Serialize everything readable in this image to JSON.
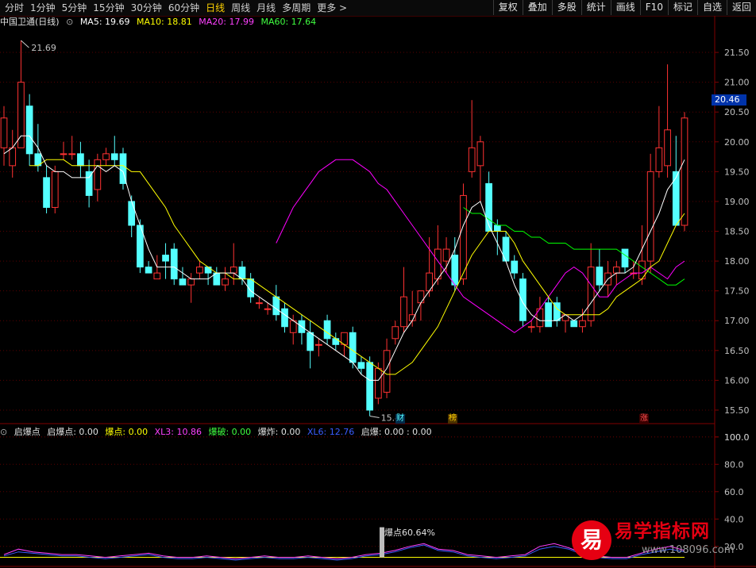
{
  "toolbar": {
    "periods": [
      "分时",
      "1分钟",
      "5分钟",
      "15分钟",
      "30分钟",
      "60分钟",
      "日线",
      "周线",
      "月线",
      "多周期",
      "更多 >"
    ],
    "active_period": "日线",
    "tools": [
      "复权",
      "叠加",
      "多股",
      "统计",
      "画线",
      "F10",
      "标记",
      "自选",
      "返回"
    ]
  },
  "price_legend": {
    "title": "中国卫通(日线)",
    "ma5": "MA5: 19.69",
    "ma10": "MA10: 18.81",
    "ma20": "MA20: 17.99",
    "ma60": "MA60: 17.64"
  },
  "indicator_legend": {
    "name": "启爆点",
    "qbd": "启爆点: 0.00",
    "bd": "爆点: 0.00",
    "xl3": "XL3: 10.86",
    "bp": "爆破: 0.00",
    "bz": "爆炸: 0.00",
    "xl6": "XL6: 12.76",
    "qb": "启爆: 0.00 : 0.00"
  },
  "current_price": "20.46",
  "high_label": "21.69",
  "low_label": "15.47",
  "markers": [
    "财",
    "榜",
    "涨"
  ],
  "indicator_annotation": "爆点60.64%",
  "watermark": {
    "badge": "易",
    "title": "易学指标网",
    "url": "www.108096.com"
  },
  "colors": {
    "up": "#ff3232",
    "down": "#54ffff",
    "ma5": "#ffffff",
    "ma10": "#ffff00",
    "ma20": "#ff00ff",
    "ma60": "#00ff00",
    "axis": "#800000"
  },
  "chart_data": [
    {
      "type": "candlestick",
      "title": "中国卫通(日线)",
      "y_ticks": [
        15.5,
        16.0,
        16.5,
        17.0,
        17.5,
        18.0,
        18.5,
        19.0,
        19.5,
        20.0,
        20.5,
        21.0,
        21.5
      ],
      "ylim": [
        15.3,
        21.9
      ],
      "ohlc": [
        [
          19.9,
          20.6,
          19.6,
          20.4
        ],
        [
          19.6,
          20.2,
          19.4,
          19.9
        ],
        [
          19.9,
          21.7,
          19.9,
          21.0
        ],
        [
          20.6,
          20.8,
          19.6,
          19.8
        ],
        [
          19.8,
          20.3,
          19.5,
          19.6
        ],
        [
          19.4,
          19.6,
          18.8,
          18.9
        ],
        [
          18.9,
          19.6,
          18.8,
          19.5
        ],
        [
          19.8,
          20.0,
          19.7,
          19.8
        ],
        [
          19.8,
          20.1,
          19.7,
          19.8
        ],
        [
          19.8,
          20.0,
          19.4,
          19.6
        ],
        [
          19.5,
          19.7,
          18.9,
          19.1
        ],
        [
          19.2,
          19.8,
          19.0,
          19.7
        ],
        [
          19.7,
          19.9,
          19.6,
          19.8
        ],
        [
          19.8,
          20.1,
          19.6,
          19.7
        ],
        [
          19.8,
          19.9,
          19.2,
          19.3
        ],
        [
          19.0,
          19.1,
          18.4,
          18.6
        ],
        [
          18.6,
          18.7,
          17.8,
          17.9
        ],
        [
          17.9,
          18.0,
          17.8,
          17.8
        ],
        [
          17.7,
          18.1,
          17.7,
          17.8
        ],
        [
          18.1,
          18.3,
          17.7,
          18.0
        ],
        [
          18.2,
          18.3,
          17.6,
          17.7
        ],
        [
          17.7,
          17.9,
          17.6,
          17.6
        ],
        [
          17.6,
          17.8,
          17.3,
          17.7
        ],
        [
          17.8,
          18.0,
          17.7,
          17.9
        ],
        [
          17.9,
          17.9,
          17.6,
          17.8
        ],
        [
          17.8,
          17.9,
          17.6,
          17.6
        ],
        [
          17.6,
          17.9,
          17.5,
          17.7
        ],
        [
          17.8,
          18.3,
          17.6,
          17.9
        ],
        [
          17.9,
          18.0,
          17.6,
          17.7
        ],
        [
          17.7,
          17.8,
          17.3,
          17.4
        ],
        [
          17.3,
          17.4,
          17.2,
          17.3
        ],
        [
          17.2,
          17.3,
          17.1,
          17.2
        ],
        [
          17.4,
          17.6,
          17.0,
          17.1
        ],
        [
          17.2,
          17.3,
          16.8,
          16.9
        ],
        [
          16.8,
          17.1,
          16.6,
          17.0
        ],
        [
          17.0,
          17.1,
          16.6,
          16.8
        ],
        [
          16.8,
          17.0,
          16.2,
          16.5
        ],
        [
          16.6,
          16.7,
          16.4,
          16.6
        ],
        [
          17.0,
          17.1,
          16.6,
          16.7
        ],
        [
          16.7,
          16.8,
          16.5,
          16.6
        ],
        [
          16.6,
          16.8,
          16.4,
          16.8
        ],
        [
          16.8,
          16.9,
          16.2,
          16.3
        ],
        [
          16.3,
          16.4,
          16.1,
          16.2
        ],
        [
          16.3,
          16.4,
          15.4,
          15.5
        ],
        [
          15.7,
          16.3,
          15.6,
          16.2
        ],
        [
          15.8,
          16.7,
          15.7,
          16.5
        ],
        [
          16.7,
          17.0,
          16.6,
          16.9
        ],
        [
          16.9,
          17.9,
          16.8,
          17.4
        ],
        [
          17.0,
          17.5,
          16.9,
          17.1
        ],
        [
          17.3,
          17.5,
          17.0,
          17.5
        ],
        [
          17.5,
          18.4,
          17.4,
          17.8
        ],
        [
          17.7,
          18.6,
          17.6,
          18.2
        ],
        [
          18.0,
          18.4,
          17.8,
          18.2
        ],
        [
          18.1,
          18.4,
          17.5,
          17.6
        ],
        [
          17.7,
          19.3,
          17.6,
          19.1
        ],
        [
          19.5,
          20.7,
          19.4,
          19.9
        ],
        [
          19.6,
          20.1,
          19.0,
          20.0
        ],
        [
          19.3,
          19.5,
          18.5,
          18.5
        ],
        [
          18.6,
          18.7,
          18.1,
          18.5
        ],
        [
          18.4,
          18.5,
          18.0,
          18.0
        ],
        [
          18.0,
          18.1,
          17.7,
          17.8
        ],
        [
          17.7,
          17.8,
          16.9,
          17.0
        ],
        [
          16.9,
          17.0,
          16.8,
          16.9
        ],
        [
          16.9,
          17.4,
          16.8,
          17.2
        ],
        [
          17.3,
          17.4,
          16.9,
          16.9
        ],
        [
          17.3,
          17.4,
          16.9,
          17.0
        ],
        [
          17.0,
          17.1,
          16.8,
          17.1
        ],
        [
          17.0,
          17.0,
          16.9,
          16.9
        ],
        [
          16.9,
          17.2,
          16.8,
          17.0
        ],
        [
          17.0,
          18.3,
          16.9,
          17.9
        ],
        [
          17.9,
          18.2,
          17.5,
          17.6
        ],
        [
          17.6,
          18.0,
          17.4,
          17.8
        ],
        [
          17.8,
          18.0,
          17.6,
          17.9
        ],
        [
          18.2,
          18.2,
          17.8,
          17.9
        ],
        [
          17.8,
          18.0,
          17.7,
          17.8
        ],
        [
          17.7,
          18.6,
          17.6,
          18.0
        ],
        [
          18.0,
          19.8,
          17.8,
          19.5
        ],
        [
          19.5,
          20.6,
          19.4,
          19.9
        ],
        [
          19.6,
          21.3,
          19.4,
          20.2
        ],
        [
          19.5,
          20.1,
          18.6,
          18.6
        ],
        [
          18.6,
          20.5,
          18.5,
          20.4
        ]
      ],
      "ma5": [
        19.8,
        19.9,
        20.1,
        20.1,
        19.9,
        19.6,
        19.5,
        19.5,
        19.4,
        19.4,
        19.4,
        19.6,
        19.5,
        19.6,
        19.5,
        19.0,
        18.6,
        18.2,
        17.9,
        17.9,
        17.9,
        17.8,
        17.7,
        17.7,
        17.7,
        17.8,
        17.8,
        17.8,
        17.7,
        17.5,
        17.4,
        17.3,
        17.2,
        17.1,
        17.0,
        16.9,
        16.8,
        16.7,
        16.6,
        16.5,
        16.4,
        16.3,
        16.1,
        16.0,
        16.0,
        16.2,
        16.5,
        16.8,
        17.0,
        17.3,
        17.5,
        17.7,
        17.9,
        18.2,
        18.6,
        18.9,
        19.0,
        18.6,
        18.3,
        18.0,
        17.6,
        17.3,
        17.1,
        17.0,
        17.0,
        17.0,
        17.1,
        17.0,
        17.1,
        17.3,
        17.5,
        17.7,
        17.8,
        17.8,
        17.9,
        18.2,
        18.5,
        18.8,
        19.2,
        19.4,
        19.7
      ],
      "ma10": [
        19.6,
        19.6,
        19.7,
        19.7,
        19.7,
        19.6,
        19.6,
        19.6,
        19.6,
        19.6,
        19.6,
        19.6,
        19.5,
        19.5,
        19.3,
        19.1,
        18.9,
        18.6,
        18.4,
        18.2,
        18.0,
        17.9,
        17.8,
        17.8,
        17.7,
        17.7,
        17.7,
        17.6,
        17.5,
        17.4,
        17.3,
        17.2,
        17.1,
        17.0,
        16.9,
        16.8,
        16.7,
        16.6,
        16.5,
        16.4,
        16.3,
        16.2,
        16.1,
        16.1,
        16.2,
        16.3,
        16.5,
        16.7,
        16.9,
        17.2,
        17.5,
        17.8,
        18.1,
        18.3,
        18.5,
        18.5,
        18.5,
        18.3,
        18.0,
        17.8,
        17.6,
        17.4,
        17.2,
        17.1,
        17.1,
        17.1,
        17.1,
        17.1,
        17.2,
        17.4,
        17.5,
        17.6,
        17.7,
        17.9,
        18.0,
        18.3,
        18.6,
        18.8
      ],
      "ma20": [
        18.3,
        18.6,
        18.9,
        19.1,
        19.3,
        19.5,
        19.6,
        19.7,
        19.7,
        19.7,
        19.6,
        19.5,
        19.3,
        19.2,
        19.0,
        18.8,
        18.6,
        18.4,
        18.2,
        18.0,
        17.8,
        17.6,
        17.4,
        17.3,
        17.2,
        17.1,
        17.0,
        16.9,
        16.8,
        16.9,
        17.0,
        17.2,
        17.4,
        17.6,
        17.8,
        17.9,
        17.8,
        17.6,
        17.4,
        17.4,
        17.6,
        17.7,
        17.8,
        17.8,
        17.9,
        17.8,
        17.7,
        17.9,
        18.0
      ],
      "ma60": [
        18.9,
        18.8,
        18.8,
        18.7,
        18.6,
        18.6,
        18.5,
        18.5,
        18.4,
        18.4,
        18.3,
        18.3,
        18.3,
        18.2,
        18.2,
        18.2,
        18.2,
        18.2,
        18.2,
        18.1,
        18.0,
        17.9,
        17.8,
        17.7,
        17.6,
        17.6,
        17.7
      ]
    },
    {
      "type": "line",
      "title": "启爆点",
      "y_ticks": [
        40.0,
        60.0,
        80.0,
        100.0
      ],
      "ylim": [
        10,
        108
      ],
      "series": [
        {
          "name": "XL3",
          "values": [
            14,
            18,
            16,
            15,
            14,
            14,
            13,
            12,
            13,
            14,
            15,
            13,
            12,
            12,
            13,
            12,
            11,
            12,
            13,
            12,
            12,
            13,
            12,
            11,
            12,
            14,
            15,
            17,
            20,
            22,
            18,
            17,
            14,
            13,
            12,
            13,
            14,
            20,
            22,
            19,
            15,
            13,
            12,
            12,
            15,
            18,
            20,
            17
          ]
        },
        {
          "name": "XL6",
          "values": [
            13,
            16,
            15,
            14,
            13,
            13,
            12,
            11,
            12,
            13,
            14,
            12,
            11,
            11,
            12,
            11,
            10,
            11,
            12,
            11,
            11,
            12,
            11,
            10,
            11,
            13,
            14,
            16,
            19,
            21,
            17,
            16,
            13,
            12,
            11,
            12,
            13,
            18,
            20,
            18,
            14,
            12,
            11,
            11,
            14,
            16,
            18,
            16
          ]
        }
      ]
    }
  ]
}
